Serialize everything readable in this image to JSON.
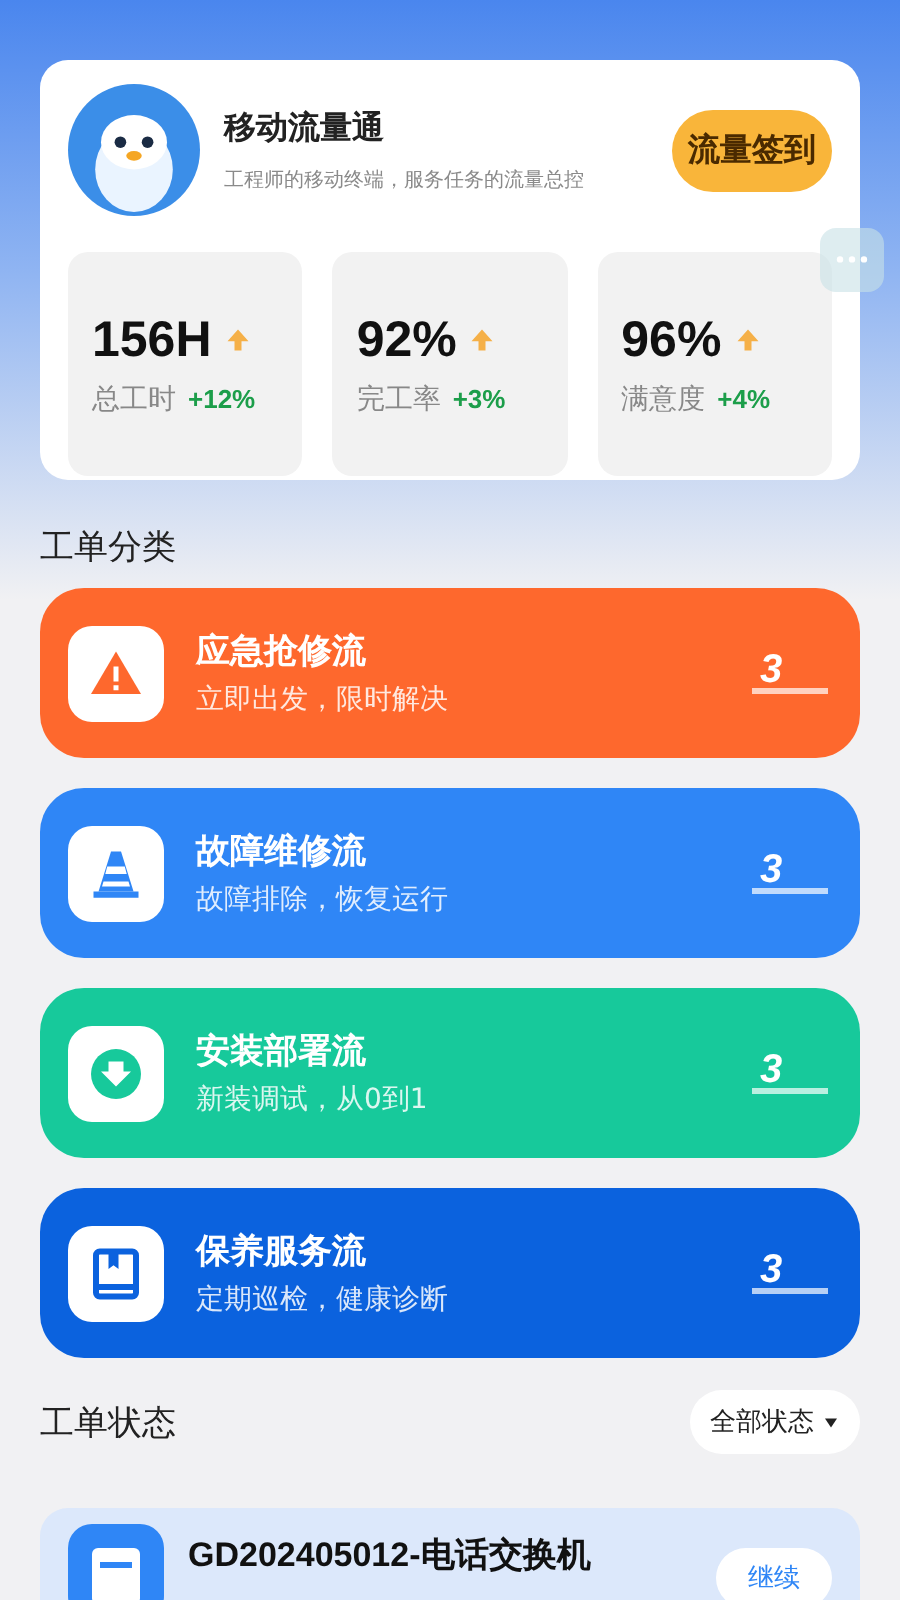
{
  "header": {
    "title": "移动流量通",
    "subtitle": "工程师的移动终端，服务任务的流量总控",
    "sign_button": "流量签到"
  },
  "stats": [
    {
      "value": "156H",
      "label": "总工时",
      "delta": "+12%"
    },
    {
      "value": "92%",
      "label": "完工率",
      "delta": "+3%"
    },
    {
      "value": "96%",
      "label": "满意度",
      "delta": "+4%"
    }
  ],
  "categories_title": "工单分类",
  "categories": [
    {
      "kind": "emergency",
      "color": "#fe682d",
      "title": "应急抢修流",
      "subtitle": "立即出发，限时解决",
      "count": "3"
    },
    {
      "kind": "repair",
      "color": "#2f86f6",
      "title": "故障维修流",
      "subtitle": "故障排除，恢复运行",
      "count": "3"
    },
    {
      "kind": "install",
      "color": "#17c99b",
      "title": "安装部署流",
      "subtitle": "新装调试，从0到1",
      "count": "3"
    },
    {
      "kind": "maintenance",
      "color": "#0b62de",
      "title": "保养服务流",
      "subtitle": "定期巡检，健康诊断",
      "count": "3"
    }
  ],
  "status_title": "工单状态",
  "status_filter": "全部状态",
  "orders": [
    {
      "title": "GD202405012-电话交换机",
      "action": "继续"
    }
  ]
}
